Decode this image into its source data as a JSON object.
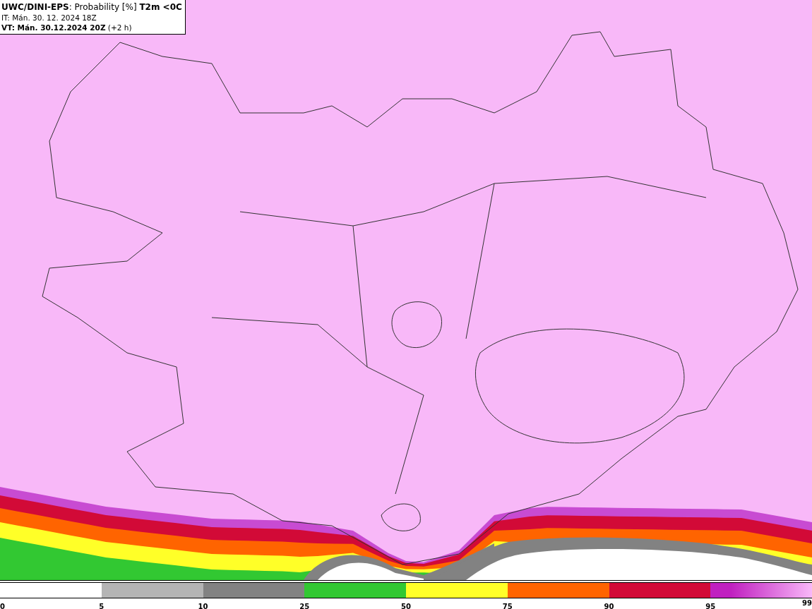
{
  "header": {
    "title": "**UWC/DINI-EPS**: Probability [%] **T2m <0C**",
    "initial_time": "IT: Mán. 30. 12. 2024 18Z",
    "valid_time": "**VT: Mán. 30.12.2024 20Z** (+2 h)"
  },
  "legend": {
    "segments": [
      {
        "color": "#ffffff",
        "label": "0"
      },
      {
        "color": "#b4b4b4",
        "label": "5"
      },
      {
        "color": "#828282",
        "label": "10"
      },
      {
        "color": "#32c832",
        "label": "25"
      },
      {
        "color": "#ffff28",
        "label": "50"
      },
      {
        "color": "#ff6400",
        "label": "75"
      },
      {
        "color": "#d20a37",
        "label": "90"
      },
      {
        "color": "#c020c0",
        "label": "95"
      }
    ],
    "end_label": "99"
  }
}
